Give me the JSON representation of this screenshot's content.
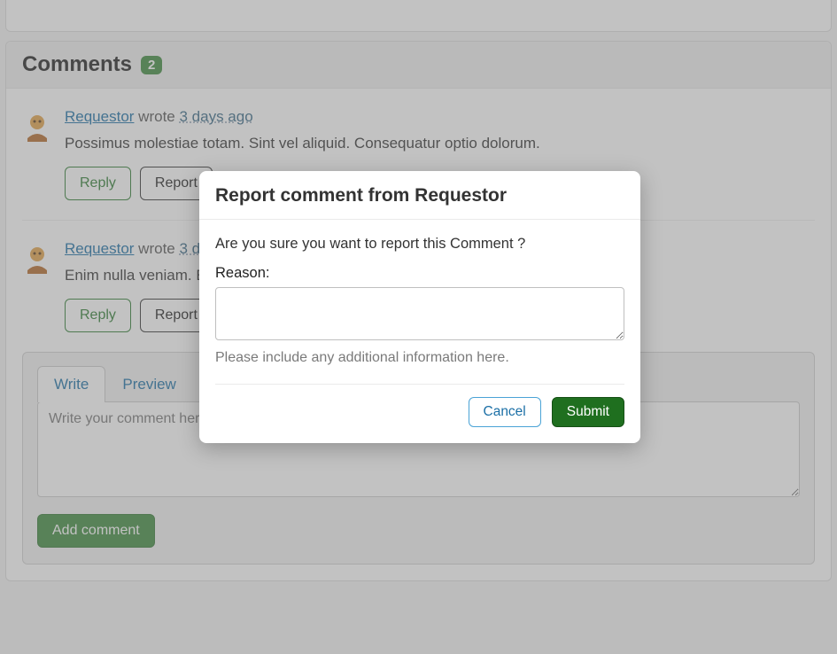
{
  "comments_section": {
    "title": "Comments",
    "count": "2"
  },
  "comments": [
    {
      "author": "Requestor",
      "wrote": "wrote",
      "time": "3 days ago",
      "body": "Possimus molestiae totam. Sint vel aliquid. Consequatur optio dolorum.",
      "reply_label": "Reply",
      "report_label": "Report"
    },
    {
      "author": "Requestor",
      "wrote": "wrote",
      "time": "3 days ago",
      "body": "Enim nulla veniam. Eu",
      "reply_label": "Reply",
      "report_label": "Report"
    }
  ],
  "editor": {
    "tab_write": "Write",
    "tab_preview": "Preview",
    "placeholder": "Write your comment here... (Markdown markup is supported)",
    "add_comment_label": "Add comment"
  },
  "modal": {
    "title": "Report comment from Requestor",
    "confirm_text": "Are you sure you want to report this Comment ?",
    "reason_label": "Reason:",
    "reason_value": "",
    "help_text": "Please include any additional information here.",
    "cancel_label": "Cancel",
    "submit_label": "Submit"
  }
}
